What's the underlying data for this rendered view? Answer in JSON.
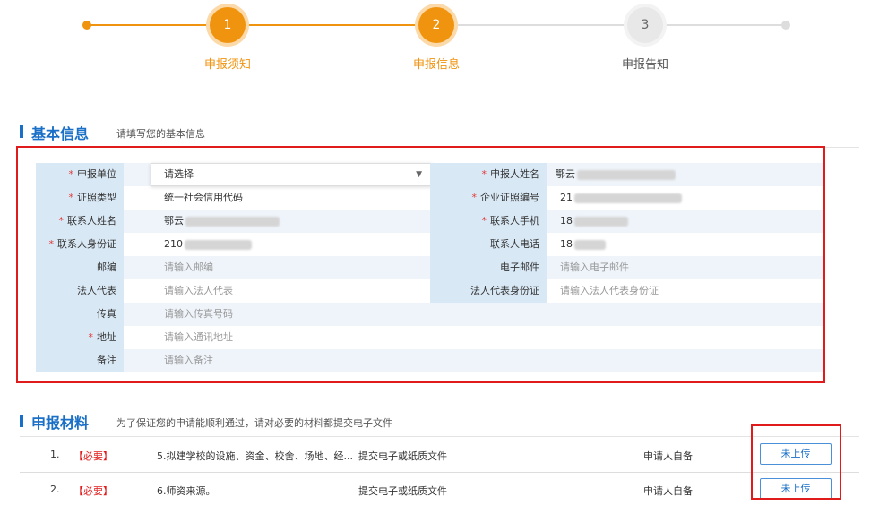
{
  "steps": [
    {
      "number": "1",
      "label": "申报须知",
      "state": "done"
    },
    {
      "number": "2",
      "label": "申报信息",
      "state": "active"
    },
    {
      "number": "3",
      "label": "申报告知",
      "state": "todo"
    }
  ],
  "colors": {
    "accent": "#f0930f",
    "primary": "#1a6fc7",
    "required": "#e01b1b"
  },
  "basic_info": {
    "title": "基本信息",
    "subtitle": "请填写您的基本信息",
    "rows": [
      {
        "l_label": "申报单位",
        "l_req": true,
        "l_value": "请选择",
        "r_label": "申报人姓名",
        "r_req": true,
        "r_value": "鄂云",
        "r_redacted": true
      },
      {
        "l_label": "证照类型",
        "l_req": true,
        "l_value": "统一社会信用代码",
        "r_label": "企业证照编号",
        "r_req": true,
        "r_value": "21",
        "r_redacted": true
      },
      {
        "l_label": "联系人姓名",
        "l_req": true,
        "l_value": "鄂云",
        "l_redacted": true,
        "r_label": "联系人手机",
        "r_req": true,
        "r_value": "18",
        "r_redacted": true
      },
      {
        "l_label": "联系人身份证",
        "l_req": true,
        "l_value": "210",
        "l_redacted": true,
        "r_label": "联系人电话",
        "r_req": false,
        "r_value": "18",
        "r_redacted": true
      },
      {
        "l_label": "邮编",
        "l_req": false,
        "l_placeholder": "请输入邮编",
        "r_label": "电子邮件",
        "r_req": false,
        "r_placeholder": "请输入电子邮件"
      },
      {
        "l_label": "法人代表",
        "l_req": false,
        "l_placeholder": "请输入法人代表",
        "r_label": "法人代表身份证",
        "r_req": false,
        "r_placeholder": "请输入法人代表身份证"
      },
      {
        "l_label": "传真",
        "l_req": false,
        "l_placeholder": "请输入传真号码"
      },
      {
        "l_label": "地址",
        "l_req": true,
        "l_placeholder": "请输入通讯地址"
      },
      {
        "l_label": "备注",
        "l_req": false,
        "l_placeholder": "请输入备注"
      }
    ]
  },
  "materials": {
    "title": "申报材料",
    "subtitle": "为了保证您的申请能顺利通过，请对必要的材料都提交电子文件",
    "items": [
      {
        "index": "1.",
        "tag": "【必要】",
        "name": "5.拟建学校的设施、资金、校舍、场地、经...",
        "type": "提交电子或纸质文件",
        "source": "申请人自备",
        "button": "未上传"
      },
      {
        "index": "2.",
        "tag": "【必要】",
        "name": "6.师资来源。",
        "type": "提交电子或纸质文件",
        "source": "申请人自备",
        "button": "未上传"
      }
    ]
  }
}
